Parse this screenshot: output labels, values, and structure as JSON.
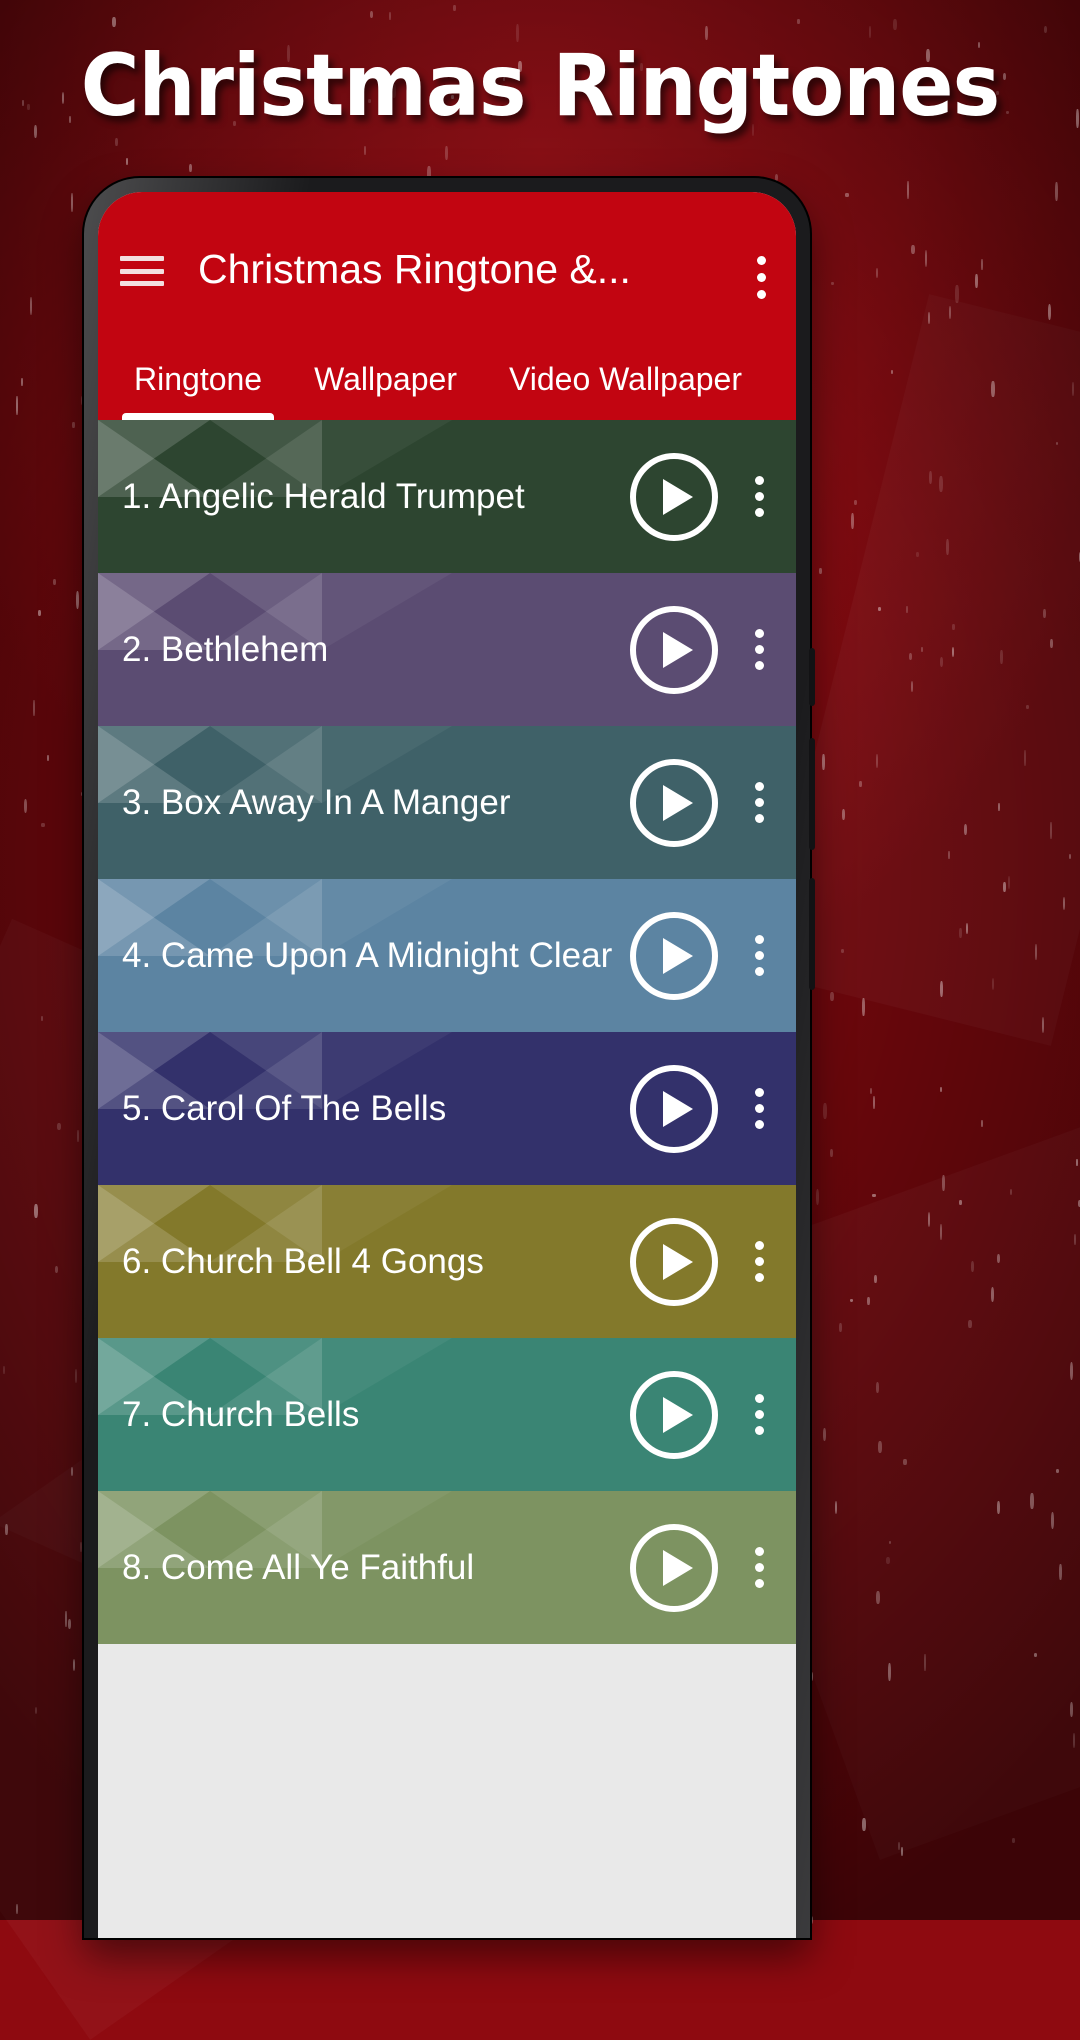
{
  "page": {
    "title": "Christmas Ringtones",
    "background_color": "#8e0a10"
  },
  "app": {
    "accent_color": "#c20511",
    "appbar": {
      "menu_icon": "hamburger-menu-icon",
      "title": "Christmas Ringtone &...",
      "overflow_icon": "more-vert-icon"
    },
    "tabs": [
      {
        "label": "Ringtone",
        "active": true
      },
      {
        "label": "Wallpaper",
        "active": false
      },
      {
        "label": "Video Wallpaper",
        "active": false
      }
    ],
    "list": {
      "play_icon": "play-icon",
      "overflow_icon": "more-vert-icon",
      "items": [
        {
          "label": "1. Angelic Herald Trumpet",
          "color": "#2d4530"
        },
        {
          "label": "2. Bethlehem",
          "color": "#5b4c72"
        },
        {
          "label": "3. Box Away In A Manger",
          "color": "#3f6168"
        },
        {
          "label": "4. Came Upon A Midnight Clear",
          "color": "#5c84a2"
        },
        {
          "label": "5. Carol Of The Bells",
          "color": "#33316b"
        },
        {
          "label": "6. Church Bell 4 Gongs",
          "color": "#83792b"
        },
        {
          "label": "7. Church Bells",
          "color": "#3a8574"
        },
        {
          "label": "8. Come All Ye Faithful",
          "color": "#7d9361"
        }
      ]
    }
  }
}
